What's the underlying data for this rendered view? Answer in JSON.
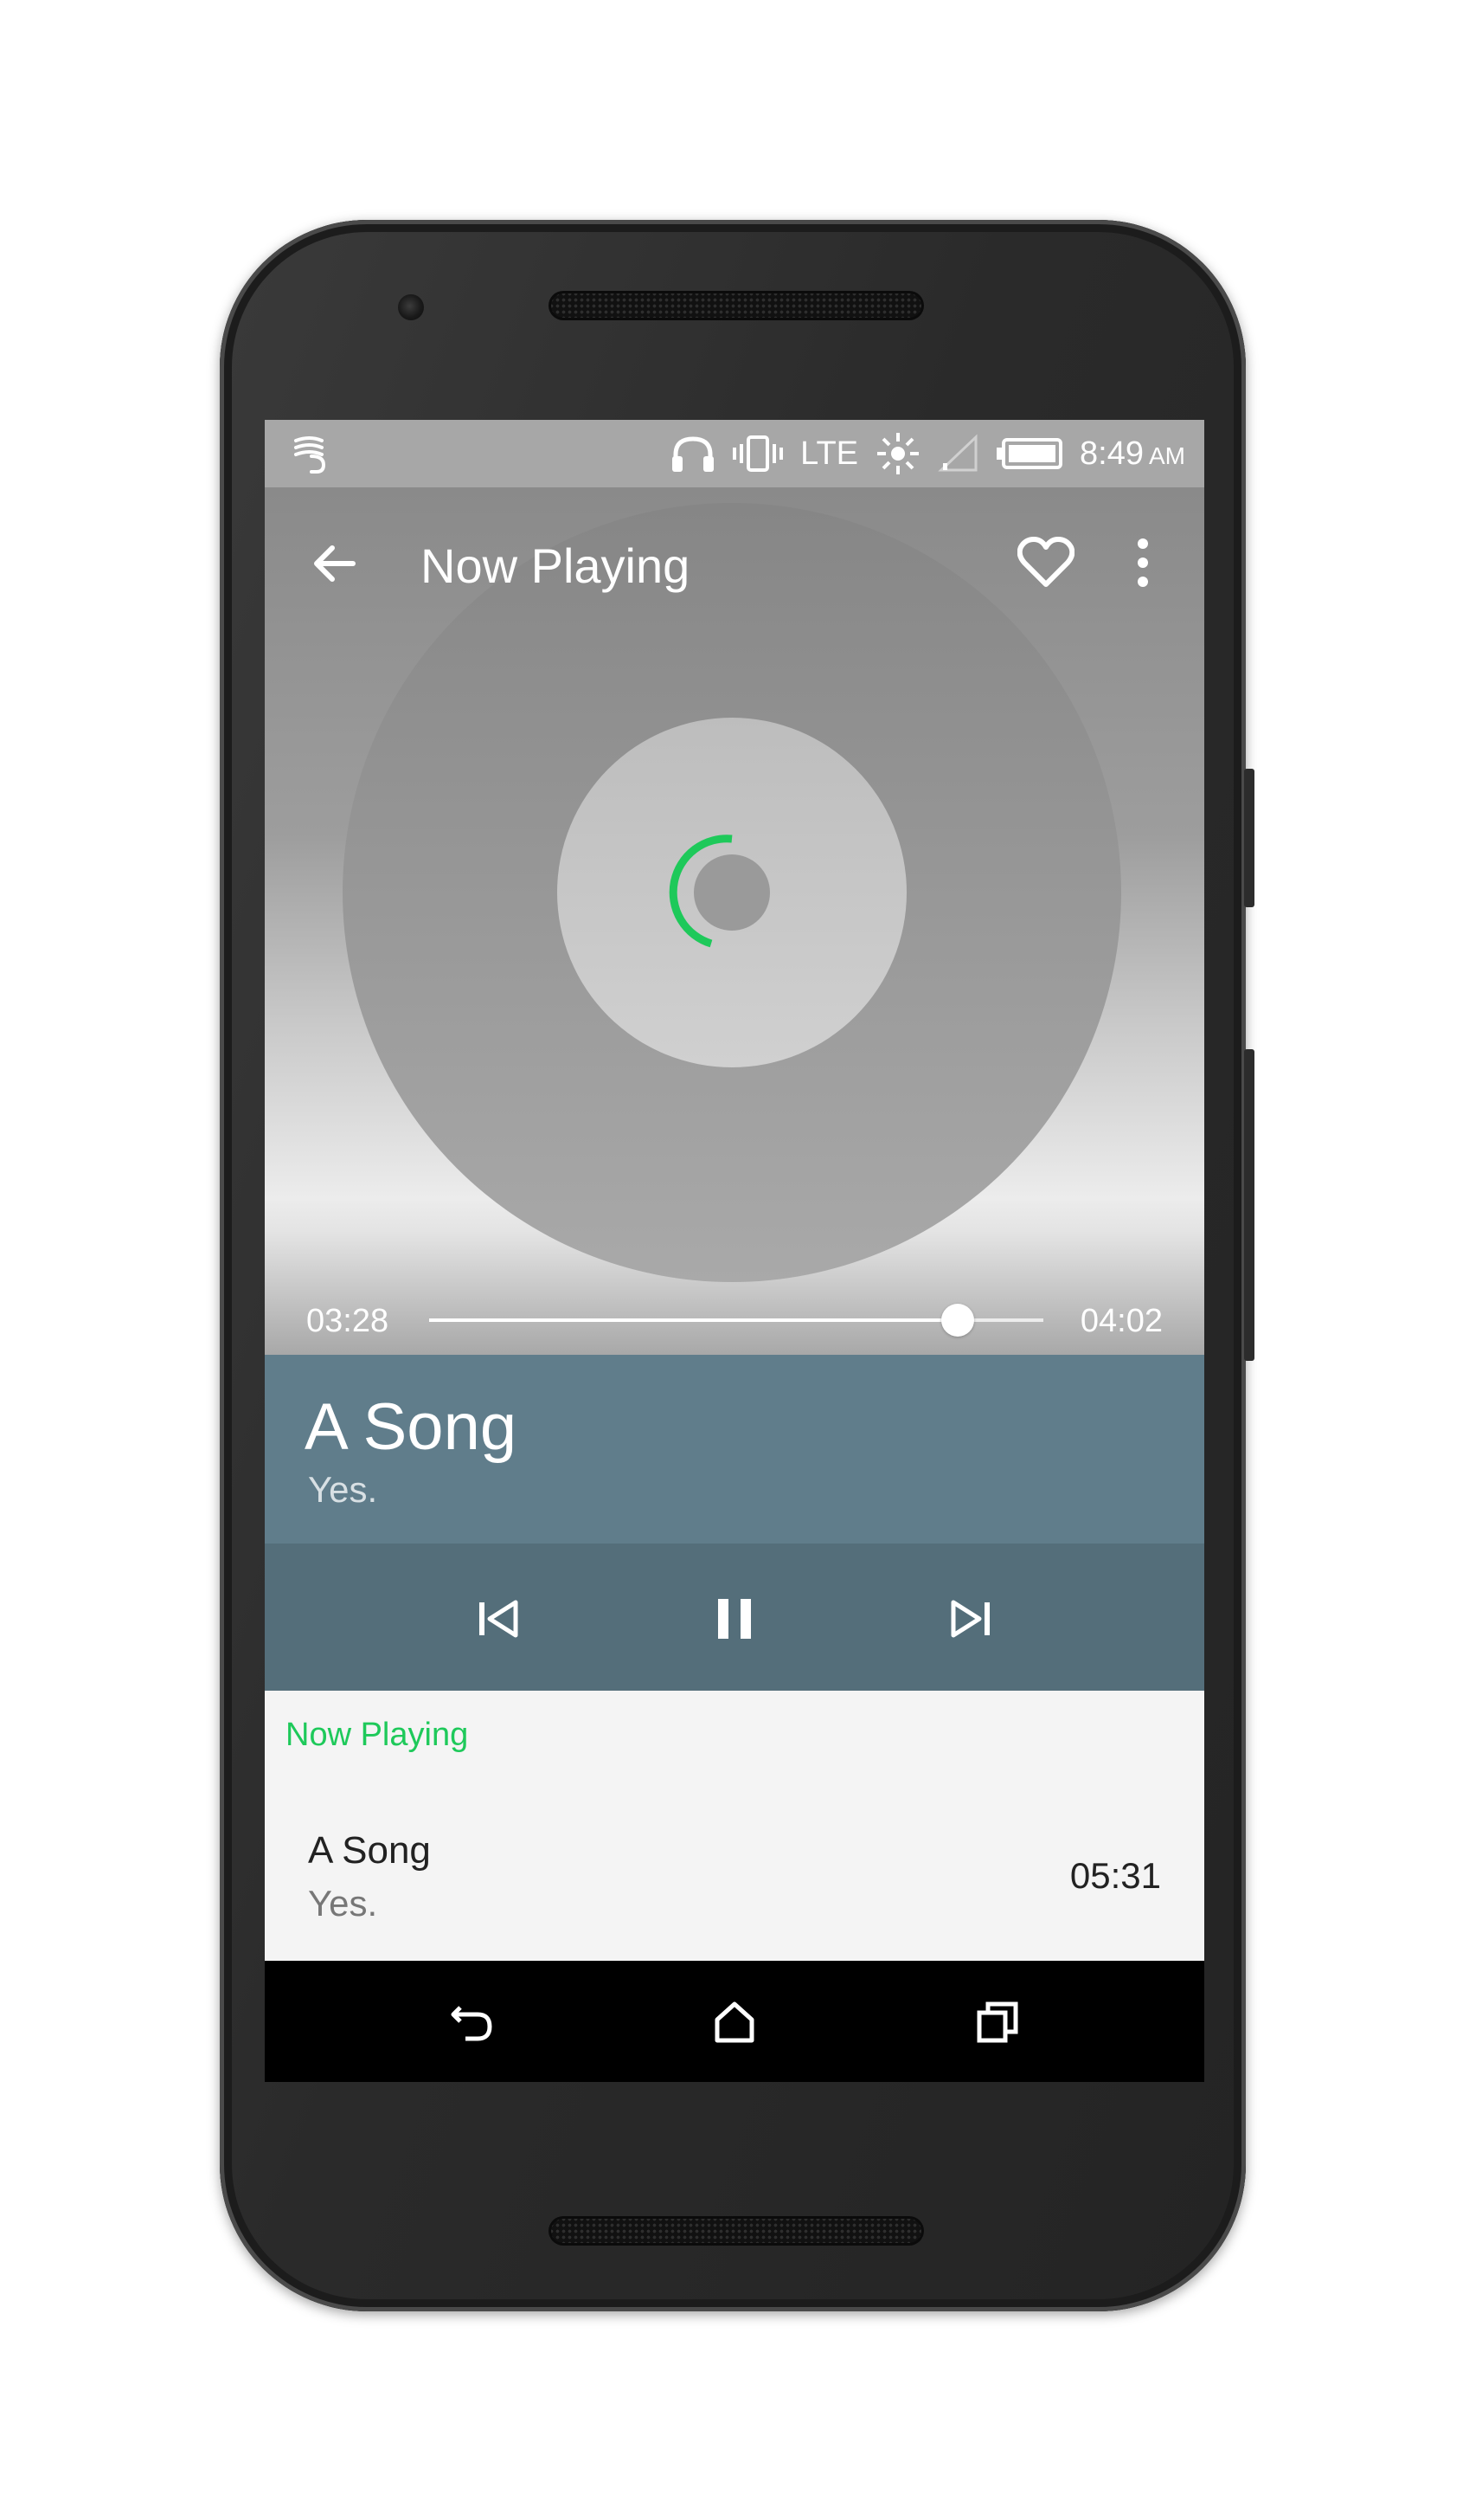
{
  "status_bar": {
    "network_label": "LTE",
    "time": "8:49",
    "ampm": "AM",
    "icons": [
      "wifi-assistant-icon",
      "headphones-icon",
      "vibrate-icon",
      "brightness-icon",
      "signal-icon",
      "battery-icon"
    ]
  },
  "toolbar": {
    "title": "Now Playing",
    "icons": [
      "back-arrow-icon",
      "heart-icon",
      "more-vert-icon"
    ]
  },
  "player": {
    "elapsed": "03:28",
    "total": "04:02",
    "progress": 0.86,
    "loading_indicator_color": "#1ec95a"
  },
  "now_playing": {
    "title": "A Song",
    "artist": "Yes."
  },
  "controls": {
    "icons": [
      "skip-previous-icon",
      "pause-icon",
      "skip-next-icon"
    ]
  },
  "queue": {
    "section_label": "Now Playing",
    "items": [
      {
        "title": "A Song",
        "artist": "Yes.",
        "duration": "05:31"
      }
    ]
  },
  "nav_bar": {
    "icons": [
      "back-icon",
      "home-icon",
      "recents-icon"
    ]
  },
  "colors": {
    "accent": "#1ec95a",
    "info_panel": "#607d8b",
    "controls_panel": "#546e7a"
  }
}
